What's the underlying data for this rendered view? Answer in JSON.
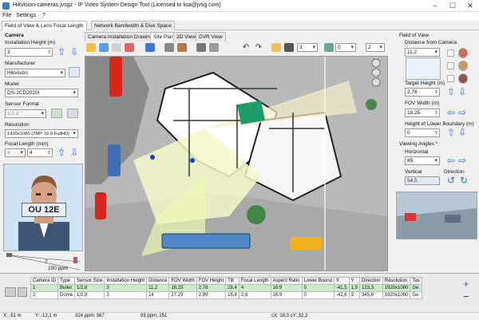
{
  "window": {
    "title": "Hikvision-cameras.jvsgz - IP Video System Design Tool (Licensed to lisa@jvsg.com)"
  },
  "menu": {
    "file": "File",
    "settings": "Settings",
    "help": "?"
  },
  "tabs": {
    "fov": "Field of View & Lens Focal Length",
    "network": "Network Bandwidth & Disk Space"
  },
  "left": {
    "camera_header": "Camera",
    "install_height_label": "Installation Height (m)",
    "install_height_value": "3",
    "manufacturer_label": "Manufacturer",
    "manufacturer_value": "Hikvision",
    "model_label": "Model",
    "model_value": "DS-2CD2020I",
    "sensor_label": "Sensor Format",
    "sensor_value": "1/2,8 \"",
    "resolution_label": "Resolution",
    "resolution_value": "1920x1080 (2MP 16:9 FullHD)",
    "focal_label": "Focal Length (mm)",
    "focal_min": "4",
    "focal_value": "4",
    "plate_text": "OU 12E",
    "ppm_value": "7",
    "ppm_label": "100 ppm"
  },
  "view_tabs": [
    "Camera Installation Drawing",
    "Site Plan",
    "3D Views",
    "DVR View"
  ],
  "toolbar": {
    "thickness": "3",
    "layer": "0",
    "zoom": "2"
  },
  "right": {
    "fov_header": "Field of View",
    "distance_label": "Distance from Camera",
    "distance_value": "11,2",
    "target_label": "Target Height (m)",
    "target_value": "2,78",
    "fovw_label": "FOV Width (m)",
    "fovw_value": "18,25",
    "lower_label": "Height of Lower Boundary (m)",
    "lower_value": "0",
    "angles_header": "Viewing Angles *",
    "horizontal_label": "Horizontal",
    "horizontal_value": "85",
    "vertical_label": "Vertical",
    "vertical_value": "54,5",
    "direction_label": "Direction"
  },
  "table": {
    "headers": [
      "Camera ID",
      "Type",
      "Sensor Size",
      "Installation Height",
      "Distance",
      "FOV Width",
      "FOV Height",
      "Tilt",
      "Focal Length",
      "Aspect Ratio",
      "Lower Bound",
      "X",
      "Y",
      "Direction",
      "Resolution",
      "Tas"
    ],
    "rows": [
      [
        "1",
        "Bullet",
        "1/2,8",
        "3",
        "11,2",
        "18,25",
        "2,78",
        "28,4",
        "4",
        "16:9",
        "0",
        "-41,5",
        "1,9",
        "123,3",
        "1920x1080",
        "Ge"
      ],
      [
        "2",
        "Dome",
        "1/2,8",
        "3",
        "14",
        "27,29",
        "2,89",
        "16,4",
        "2,8",
        "16:9",
        "0",
        "-42,6",
        "3",
        "345,6",
        "1920x1080",
        "Ge"
      ]
    ]
  },
  "status": {
    "x": "X: -51 m",
    "y": "Y: -12,1 m",
    "ppm1": "324 ppm; 367",
    "ppm2": "93 ppm; 251",
    "coords": "cX: 18,3 cY: 32,2"
  }
}
